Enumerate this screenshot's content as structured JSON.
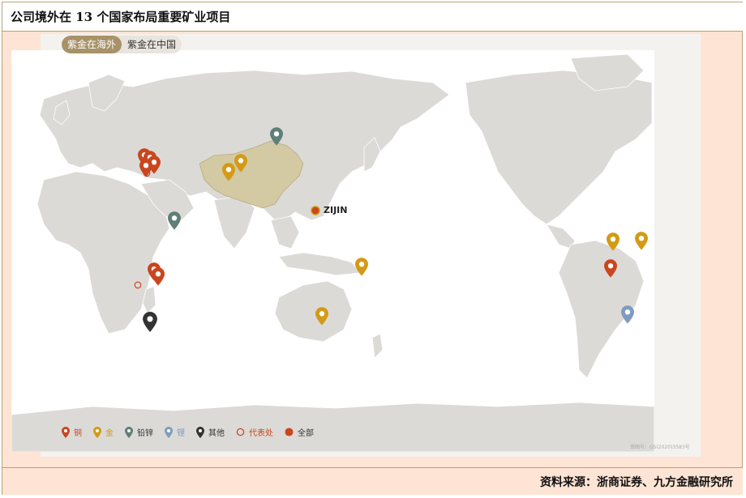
{
  "title": "公司境外在 13 个国家布局重要矿业项目",
  "tabs": [
    {
      "label": "紫金在海外",
      "active": true
    },
    {
      "label": "紫金在中国",
      "active": false
    }
  ],
  "brand": "ZIJIN",
  "watermark": "审图号：GS(2020)3583号",
  "colors": {
    "copper": "#c9461e",
    "gold": "#d39a15",
    "lead_zinc": "#5f7f78",
    "lithium": "#7f9bbf",
    "other": "#333333",
    "office": "#c9461e",
    "china": "#d3c9a2",
    "land": "#dcdad7"
  },
  "legend": [
    {
      "label": "铜",
      "type": "copper",
      "icon": "pin-icon"
    },
    {
      "label": "金",
      "type": "gold",
      "icon": "pin-icon"
    },
    {
      "label": "铅锌",
      "type": "lead_zinc",
      "icon": "pin-icon"
    },
    {
      "label": "锂",
      "type": "lithium",
      "icon": "pin-icon"
    },
    {
      "label": "其他",
      "type": "other",
      "icon": "pin-icon"
    },
    {
      "label": "代表处",
      "type": "office",
      "icon": "ring-icon"
    },
    {
      "label": "全部",
      "type": "all",
      "icon": "dot-icon"
    }
  ],
  "markers": [
    {
      "type": "copper"
    },
    {
      "type": "copper"
    },
    {
      "type": "copper"
    },
    {
      "type": "copper"
    },
    {
      "type": "copper"
    },
    {
      "type": "copper"
    },
    {
      "type": "gold"
    },
    {
      "type": "gold"
    },
    {
      "type": "gold"
    },
    {
      "type": "gold"
    },
    {
      "type": "gold"
    },
    {
      "type": "gold"
    },
    {
      "type": "lead_zinc"
    },
    {
      "type": "lead_zinc"
    },
    {
      "type": "lithium"
    },
    {
      "type": "other"
    },
    {
      "type": "office"
    },
    {
      "type": "office"
    }
  ],
  "source": "资料来源：浙商证券、九方金融研究所"
}
